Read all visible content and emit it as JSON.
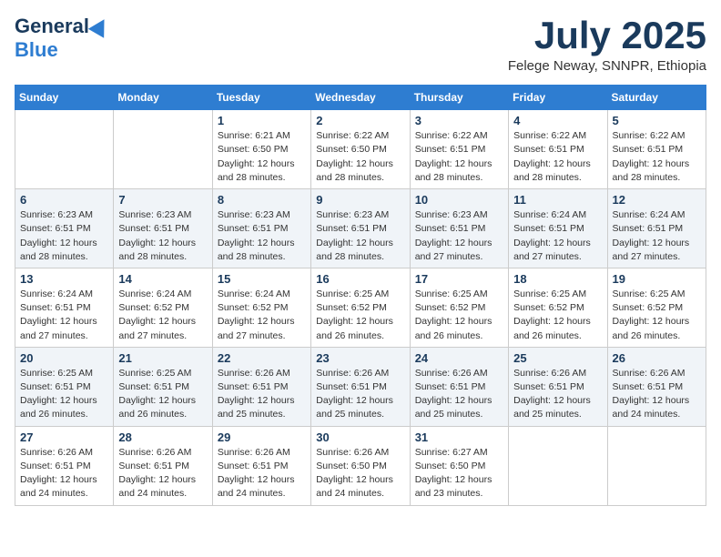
{
  "header": {
    "logo_general": "General",
    "logo_blue": "Blue",
    "month_title": "July 2025",
    "location": "Felege Neway, SNNPR, Ethiopia"
  },
  "days_of_week": [
    "Sunday",
    "Monday",
    "Tuesday",
    "Wednesday",
    "Thursday",
    "Friday",
    "Saturday"
  ],
  "weeks": [
    [
      {
        "day": "",
        "sunrise": "",
        "sunset": "",
        "daylight": ""
      },
      {
        "day": "",
        "sunrise": "",
        "sunset": "",
        "daylight": ""
      },
      {
        "day": "1",
        "sunrise": "Sunrise: 6:21 AM",
        "sunset": "Sunset: 6:50 PM",
        "daylight": "Daylight: 12 hours and 28 minutes."
      },
      {
        "day": "2",
        "sunrise": "Sunrise: 6:22 AM",
        "sunset": "Sunset: 6:50 PM",
        "daylight": "Daylight: 12 hours and 28 minutes."
      },
      {
        "day": "3",
        "sunrise": "Sunrise: 6:22 AM",
        "sunset": "Sunset: 6:51 PM",
        "daylight": "Daylight: 12 hours and 28 minutes."
      },
      {
        "day": "4",
        "sunrise": "Sunrise: 6:22 AM",
        "sunset": "Sunset: 6:51 PM",
        "daylight": "Daylight: 12 hours and 28 minutes."
      },
      {
        "day": "5",
        "sunrise": "Sunrise: 6:22 AM",
        "sunset": "Sunset: 6:51 PM",
        "daylight": "Daylight: 12 hours and 28 minutes."
      }
    ],
    [
      {
        "day": "6",
        "sunrise": "Sunrise: 6:23 AM",
        "sunset": "Sunset: 6:51 PM",
        "daylight": "Daylight: 12 hours and 28 minutes."
      },
      {
        "day": "7",
        "sunrise": "Sunrise: 6:23 AM",
        "sunset": "Sunset: 6:51 PM",
        "daylight": "Daylight: 12 hours and 28 minutes."
      },
      {
        "day": "8",
        "sunrise": "Sunrise: 6:23 AM",
        "sunset": "Sunset: 6:51 PM",
        "daylight": "Daylight: 12 hours and 28 minutes."
      },
      {
        "day": "9",
        "sunrise": "Sunrise: 6:23 AM",
        "sunset": "Sunset: 6:51 PM",
        "daylight": "Daylight: 12 hours and 28 minutes."
      },
      {
        "day": "10",
        "sunrise": "Sunrise: 6:23 AM",
        "sunset": "Sunset: 6:51 PM",
        "daylight": "Daylight: 12 hours and 27 minutes."
      },
      {
        "day": "11",
        "sunrise": "Sunrise: 6:24 AM",
        "sunset": "Sunset: 6:51 PM",
        "daylight": "Daylight: 12 hours and 27 minutes."
      },
      {
        "day": "12",
        "sunrise": "Sunrise: 6:24 AM",
        "sunset": "Sunset: 6:51 PM",
        "daylight": "Daylight: 12 hours and 27 minutes."
      }
    ],
    [
      {
        "day": "13",
        "sunrise": "Sunrise: 6:24 AM",
        "sunset": "Sunset: 6:51 PM",
        "daylight": "Daylight: 12 hours and 27 minutes."
      },
      {
        "day": "14",
        "sunrise": "Sunrise: 6:24 AM",
        "sunset": "Sunset: 6:52 PM",
        "daylight": "Daylight: 12 hours and 27 minutes."
      },
      {
        "day": "15",
        "sunrise": "Sunrise: 6:24 AM",
        "sunset": "Sunset: 6:52 PM",
        "daylight": "Daylight: 12 hours and 27 minutes."
      },
      {
        "day": "16",
        "sunrise": "Sunrise: 6:25 AM",
        "sunset": "Sunset: 6:52 PM",
        "daylight": "Daylight: 12 hours and 26 minutes."
      },
      {
        "day": "17",
        "sunrise": "Sunrise: 6:25 AM",
        "sunset": "Sunset: 6:52 PM",
        "daylight": "Daylight: 12 hours and 26 minutes."
      },
      {
        "day": "18",
        "sunrise": "Sunrise: 6:25 AM",
        "sunset": "Sunset: 6:52 PM",
        "daylight": "Daylight: 12 hours and 26 minutes."
      },
      {
        "day": "19",
        "sunrise": "Sunrise: 6:25 AM",
        "sunset": "Sunset: 6:52 PM",
        "daylight": "Daylight: 12 hours and 26 minutes."
      }
    ],
    [
      {
        "day": "20",
        "sunrise": "Sunrise: 6:25 AM",
        "sunset": "Sunset: 6:51 PM",
        "daylight": "Daylight: 12 hours and 26 minutes."
      },
      {
        "day": "21",
        "sunrise": "Sunrise: 6:25 AM",
        "sunset": "Sunset: 6:51 PM",
        "daylight": "Daylight: 12 hours and 26 minutes."
      },
      {
        "day": "22",
        "sunrise": "Sunrise: 6:26 AM",
        "sunset": "Sunset: 6:51 PM",
        "daylight": "Daylight: 12 hours and 25 minutes."
      },
      {
        "day": "23",
        "sunrise": "Sunrise: 6:26 AM",
        "sunset": "Sunset: 6:51 PM",
        "daylight": "Daylight: 12 hours and 25 minutes."
      },
      {
        "day": "24",
        "sunrise": "Sunrise: 6:26 AM",
        "sunset": "Sunset: 6:51 PM",
        "daylight": "Daylight: 12 hours and 25 minutes."
      },
      {
        "day": "25",
        "sunrise": "Sunrise: 6:26 AM",
        "sunset": "Sunset: 6:51 PM",
        "daylight": "Daylight: 12 hours and 25 minutes."
      },
      {
        "day": "26",
        "sunrise": "Sunrise: 6:26 AM",
        "sunset": "Sunset: 6:51 PM",
        "daylight": "Daylight: 12 hours and 24 minutes."
      }
    ],
    [
      {
        "day": "27",
        "sunrise": "Sunrise: 6:26 AM",
        "sunset": "Sunset: 6:51 PM",
        "daylight": "Daylight: 12 hours and 24 minutes."
      },
      {
        "day": "28",
        "sunrise": "Sunrise: 6:26 AM",
        "sunset": "Sunset: 6:51 PM",
        "daylight": "Daylight: 12 hours and 24 minutes."
      },
      {
        "day": "29",
        "sunrise": "Sunrise: 6:26 AM",
        "sunset": "Sunset: 6:51 PM",
        "daylight": "Daylight: 12 hours and 24 minutes."
      },
      {
        "day": "30",
        "sunrise": "Sunrise: 6:26 AM",
        "sunset": "Sunset: 6:50 PM",
        "daylight": "Daylight: 12 hours and 24 minutes."
      },
      {
        "day": "31",
        "sunrise": "Sunrise: 6:27 AM",
        "sunset": "Sunset: 6:50 PM",
        "daylight": "Daylight: 12 hours and 23 minutes."
      },
      {
        "day": "",
        "sunrise": "",
        "sunset": "",
        "daylight": ""
      },
      {
        "day": "",
        "sunrise": "",
        "sunset": "",
        "daylight": ""
      }
    ]
  ]
}
